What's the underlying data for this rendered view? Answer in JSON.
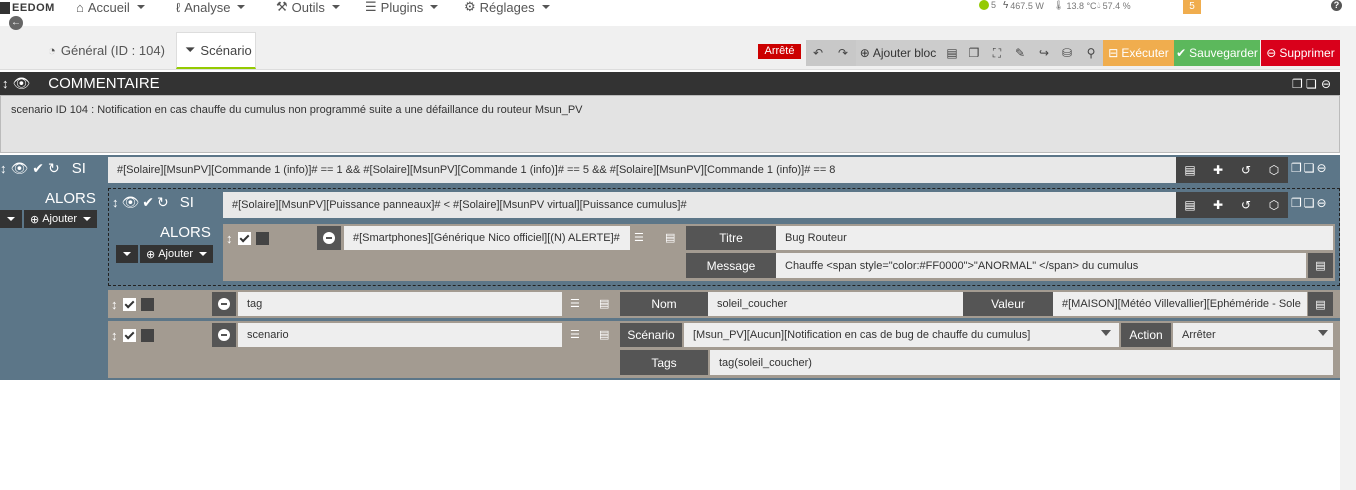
{
  "nav": {
    "logo_text": "EEDOM",
    "items": [
      {
        "label": "Accueil",
        "icon": "home-icon"
      },
      {
        "label": "Analyse",
        "icon": "stethoscope-icon"
      },
      {
        "label": "Outils",
        "icon": "wrench-icon"
      },
      {
        "label": "Plugins",
        "icon": "tasks-icon"
      },
      {
        "label": "Réglages",
        "icon": "cogs-icon"
      }
    ],
    "status": {
      "users": "5",
      "power": "467.5 W",
      "temperature": "13.8 °C",
      "humidity": "57.4 %",
      "notifications": "5"
    }
  },
  "tabs": {
    "general": "Général (ID : 104)",
    "scenario": "Scénario"
  },
  "toolbar": {
    "state": "Arrêté",
    "add_block": "Ajouter bloc",
    "execute": "Exécuter",
    "save": "Sauvegarder",
    "delete": "Supprimer"
  },
  "comment": {
    "title": "COMMENTAIRE",
    "text": "scenario ID 104 : Notification en cas chauffe du cumulus non programmé suite a une défaillance du routeur Msun_PV"
  },
  "block1": {
    "si": "SI",
    "alors": "ALORS",
    "add": "Ajouter",
    "condition": "#[Solaire][MsunPV][Commande 1 (info)]# == 1 && #[Solaire][MsunPV][Commande 1 (info)]# == 5 && #[Solaire][MsunPV][Commande 1 (info)]# == 8"
  },
  "block2": {
    "si": "SI",
    "alors": "ALORS",
    "add": "Ajouter",
    "condition": "#[Solaire][MsunPV][Puissance panneaux]# < #[Solaire][MsunPV virtual][Puissance cumulus]#",
    "action_cmd": "#[Smartphones][Générique Nico officiel][(N) ALERTE]#",
    "titre_label": "Titre",
    "titre_value": "Bug Routeur",
    "message_label": "Message",
    "message_value": "Chauffe <span style=\"color:#FF0000\">\"ANORMAL\" </span> du cumulus"
  },
  "action_tag": {
    "cmd": "tag",
    "nom_label": "Nom",
    "nom_value": "soleil_coucher",
    "valeur_label": "Valeur",
    "valeur_value": "#[MAISON][Météo Villevallier][Ephéméride - Sole"
  },
  "action_scenario": {
    "cmd": "scenario",
    "scenario_label": "Scénario",
    "scenario_value": "[Msun_PV][Aucun][Notification en cas de bug de chauffe du cumulus]",
    "action_label": "Action",
    "action_value": "Arrêter",
    "tags_label": "Tags",
    "tags_value": "tag(soleil_coucher)"
  }
}
